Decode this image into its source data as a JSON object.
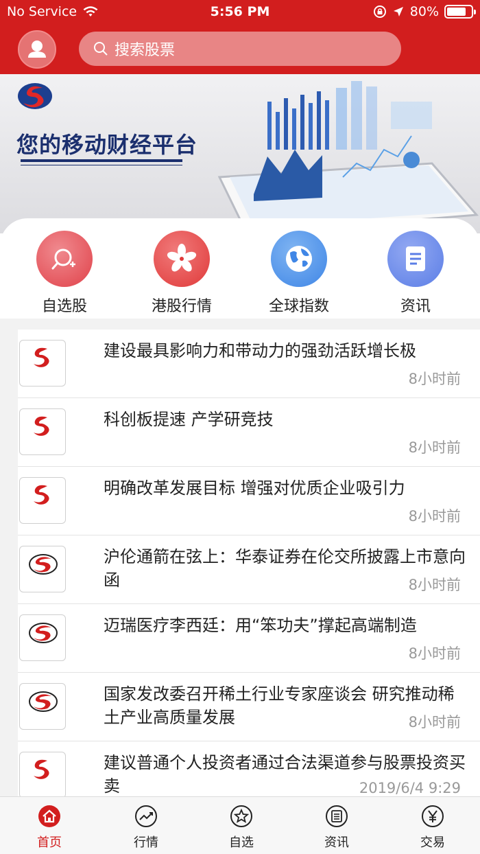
{
  "status_bar": {
    "carrier": "No Service",
    "time": "5:56 PM",
    "battery": "80%",
    "battery_level": 0.8
  },
  "search": {
    "placeholder": "搜索股票"
  },
  "banner": {
    "title": "您的移动财经平台"
  },
  "quick_actions": [
    {
      "label": "自选股",
      "icon": "search-add-icon",
      "color": "#e0424a"
    },
    {
      "label": "港股行情",
      "icon": "bauhinia-icon",
      "color": "#e03a3a"
    },
    {
      "label": "全球指数",
      "icon": "globe-icon",
      "color": "#3f86e6"
    },
    {
      "label": "资讯",
      "icon": "document-icon",
      "color": "#5b7ee6"
    }
  ],
  "news": [
    {
      "title": "建设最具影响力和带动力的强劲活跃增长极",
      "time": "8小时前",
      "source_logo": "中国证券报"
    },
    {
      "title": "科创板提速 产学研竞技",
      "time": "8小时前",
      "source_logo": "中国证券报"
    },
    {
      "title": "明确改革发展目标 增强对优质企业吸引力",
      "time": "8小时前",
      "source_logo": "中国证券报"
    },
    {
      "title": "沪伦通箭在弦上：华泰证券在伦交所披露上市意向函",
      "time": "8小时前",
      "source_logo": "上海证券报"
    },
    {
      "title": "迈瑞医疗李西廷：用“笨功夫”撑起高端制造",
      "time": "8小时前",
      "source_logo": "上海证券报"
    },
    {
      "title": "国家发改委召开稀土行业专家座谈会 研究推动稀土产业高质量发展",
      "time": "8小时前",
      "source_logo": "上海证券报"
    },
    {
      "title": "建议普通个人投资者通过合法渠道参与股票投资买卖",
      "time": "2019/6/4 9:29",
      "source_logo": "中国证券报"
    }
  ],
  "tabs": [
    {
      "label": "首页",
      "icon": "home-icon",
      "active": true
    },
    {
      "label": "行情",
      "icon": "chart-icon",
      "active": false
    },
    {
      "label": "自选",
      "icon": "star-icon",
      "active": false
    },
    {
      "label": "资讯",
      "icon": "news-icon",
      "active": false
    },
    {
      "label": "交易",
      "icon": "yen-icon",
      "active": false
    }
  ],
  "colors": {
    "brand_red": "#d21e1e",
    "text_primary": "#222222",
    "text_secondary": "#999999",
    "banner_blue": "#1b2f6e"
  }
}
